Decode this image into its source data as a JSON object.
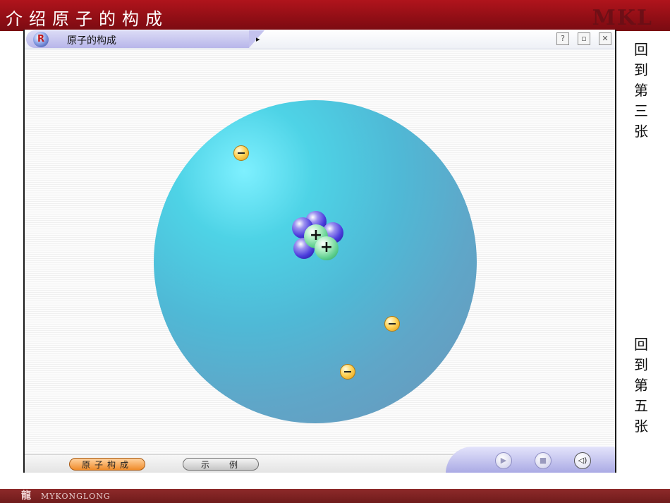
{
  "slide": {
    "title": "介绍原子的构成",
    "brand": "MKL"
  },
  "window": {
    "title": "原子的构成",
    "tab_arrow": "▸",
    "controls": {
      "help": "?",
      "restore": "▫",
      "close": "✕"
    }
  },
  "atom": {
    "electron_symbol": "−",
    "proton_symbol": "+"
  },
  "bottombar": {
    "buttons": [
      {
        "label": "原子构成",
        "active": true
      },
      {
        "label": "示例",
        "active": false
      }
    ],
    "media": {
      "play": "▶",
      "stop": "■",
      "sound": "◁)"
    }
  },
  "sidelinks": {
    "third": "回到第三张",
    "fifth": "回到第五张"
  },
  "footer": {
    "logo": "龍",
    "text": "MYKONGLONG"
  },
  "colors": {
    "header_red": "#8a0d14",
    "atom_blue": "#4fb9d6",
    "electron_yellow": "#ffd45a",
    "active_button_orange": "#f08c2a",
    "footer_red": "#7a2020"
  }
}
